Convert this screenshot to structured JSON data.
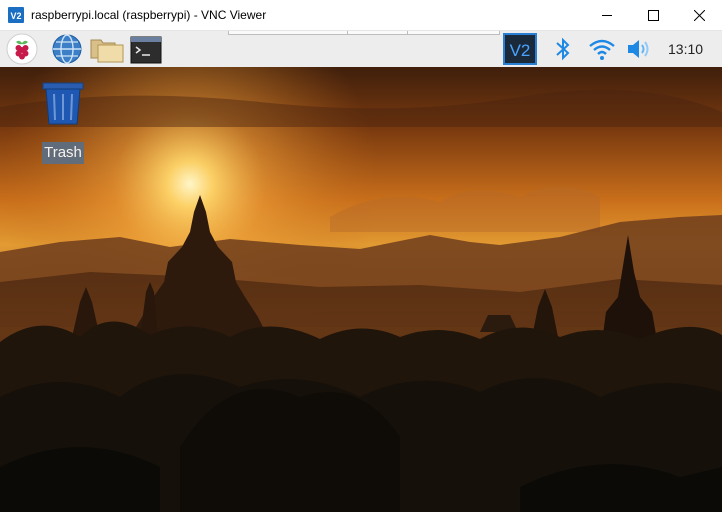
{
  "window": {
    "title": "raspberrypi.local (raspberrypi) - VNC Viewer",
    "app_icon": "vnc-viewer-icon",
    "controls": [
      "minimize-icon",
      "maximize-icon",
      "close-icon"
    ]
  },
  "taskbar": {
    "launchers": [
      "raspberry-menu-icon",
      "web-browser-icon",
      "file-manager-icon",
      "terminal-icon"
    ],
    "tray": [
      "vnc-server-icon",
      "bluetooth-icon",
      "wifi-icon",
      "volume-icon"
    ],
    "clock": "13:10"
  },
  "desktop": {
    "icons": [
      {
        "label": "Trash",
        "icon": "trash-icon"
      }
    ],
    "wallpaper": "sunset-temples-landscape"
  },
  "colors": {
    "vnc_blue": "#1a6fc3",
    "taskbar": "#ededed",
    "accent_blue": "#1e88e5"
  }
}
